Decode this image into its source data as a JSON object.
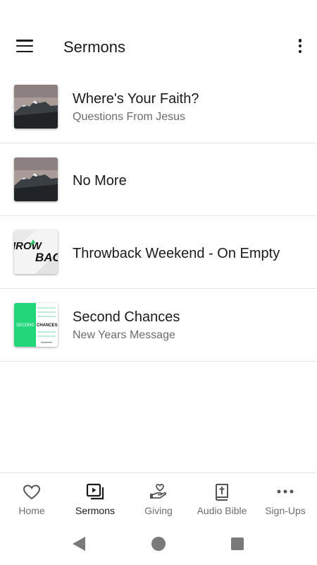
{
  "app_bar": {
    "title": "Sermons",
    "menu_icon": "hamburger-menu-icon",
    "more_icon": "more-vertical-icon"
  },
  "sermons": [
    {
      "title": "Where's Your Faith?",
      "subtitle": "Questions From Jesus",
      "thumbnail": "mountain-image"
    },
    {
      "title": "No More",
      "subtitle": "",
      "thumbnail": "mountain-image"
    },
    {
      "title": "Throwback Weekend - On Empty",
      "subtitle": "",
      "thumbnail": "throwback-graphic",
      "thumbnail_text": [
        "IROW",
        "BAC"
      ]
    },
    {
      "title": "Second Chances",
      "subtitle": "New Years Message",
      "thumbnail": "second-chances-graphic",
      "thumbnail_text": [
        "SECOND",
        "CHANCES"
      ]
    }
  ],
  "bottom_nav": {
    "items": [
      {
        "label": "Home",
        "icon": "heart-icon",
        "active": false
      },
      {
        "label": "Sermons",
        "icon": "video-library-icon",
        "active": true
      },
      {
        "label": "Giving",
        "icon": "hand-heart-icon",
        "active": false
      },
      {
        "label": "Audio Bible",
        "icon": "bible-icon",
        "active": false
      },
      {
        "label": "Sign-Ups",
        "icon": "more-horizontal-icon",
        "active": false
      }
    ]
  },
  "system_nav": {
    "back_icon": "back-triangle-icon",
    "home_icon": "home-circle-icon",
    "recent_icon": "recent-square-icon"
  },
  "colors": {
    "text_primary": "#1a1a1a",
    "text_secondary": "#6b6b6b",
    "divider": "#e6e6e6",
    "accent_green": "#22d67a"
  }
}
